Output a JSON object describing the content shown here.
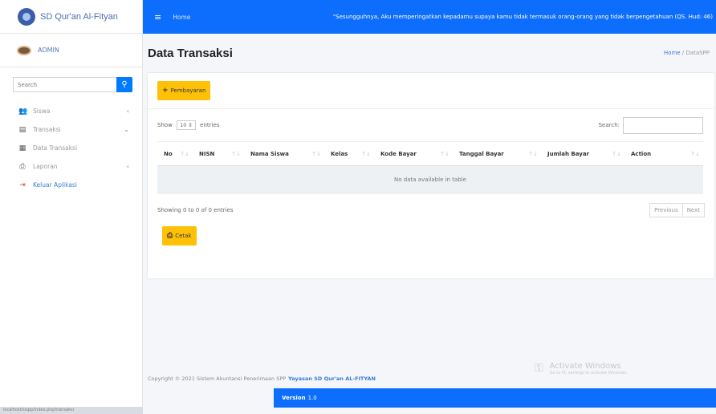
{
  "brand": {
    "name": "SD Qur'an Al-Fityan"
  },
  "user": {
    "name": "ADMIN"
  },
  "sidebar": {
    "search_placeholder": "Search",
    "items": [
      {
        "label": "Siswa",
        "icon": "users-icon",
        "arrow": "‹"
      },
      {
        "label": "Transaksi",
        "icon": "book-icon",
        "arrow": "⌄"
      },
      {
        "label": "Data Transaksi",
        "icon": "table-icon",
        "arrow": ""
      },
      {
        "label": "Laporan",
        "icon": "print-icon",
        "arrow": "‹"
      },
      {
        "label": "Keluar Aplikasi",
        "icon": "logout-icon",
        "arrow": ""
      }
    ]
  },
  "topbar": {
    "home": "Home",
    "quote": "\"Sesungguhnya, Aku memperingatkan kepadamu supaya kamu tidak termasuk orang-orang yang tidak berpengetahuan (QS. Hud: 46)"
  },
  "page": {
    "title": "Data Transaksi",
    "breadcrumb_home": "Home",
    "breadcrumb_sep": " / ",
    "breadcrumb_current": "DataSPP"
  },
  "card": {
    "add_button": "Pembayaran",
    "show_label": "Show",
    "entries_value": "10",
    "entries_label": "entries",
    "search_label": "Search:",
    "columns": [
      "No",
      "NISN",
      "Nama Siswa",
      "Kelas",
      "Kode Bayar",
      "Tanggal Bayar",
      "Jumlah Bayar",
      "Action"
    ],
    "empty_text": "No data available in table",
    "info_text": "Showing 0 to 0 of 0 entries",
    "prev": "Previous",
    "next": "Next",
    "print_button": "Cetak"
  },
  "footer": {
    "copyright": "Copyright © 2021 Sistem Akuntansi Penerimaan SPP",
    "org": "Yayasan SD Qur'an AL-FITYAN",
    "version_label": "Version",
    "version_value": "1.0"
  },
  "watermark": {
    "title": "Activate Windows",
    "subtitle": "Go to PC settings to activate Windows."
  },
  "status_url": "localhost/sispp/index.php/transaksi"
}
